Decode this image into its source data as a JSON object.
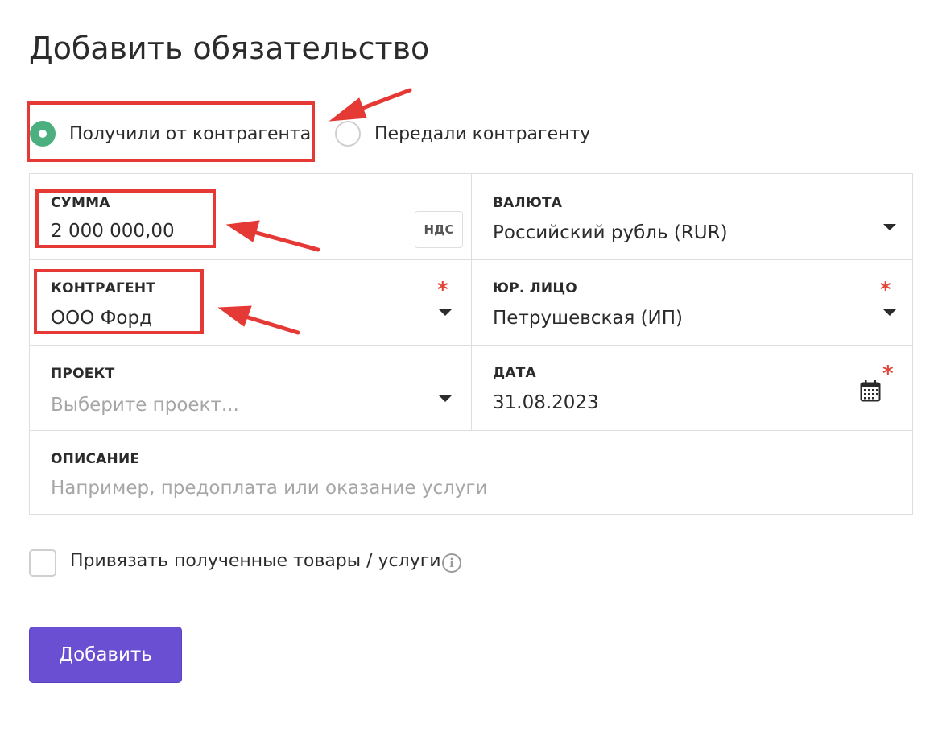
{
  "page": {
    "title": "Добавить обязательство"
  },
  "direction": {
    "options": [
      {
        "label": "Получили от контрагента",
        "selected": true
      },
      {
        "label": "Передали контрагенту",
        "selected": false
      }
    ]
  },
  "fields": {
    "amount": {
      "label": "СУММА",
      "value": "2 000 000,00",
      "vat_button": "НДС"
    },
    "currency": {
      "label": "ВАЛЮТА",
      "value": "Российский рубль (RUR)"
    },
    "counterparty": {
      "label": "КОНТРАГЕНТ",
      "value": "ООО Форд",
      "required_mark": "*"
    },
    "legal_entity": {
      "label": "ЮР. ЛИЦО",
      "value": "Петрушевская (ИП)",
      "required_mark": "*"
    },
    "project": {
      "label": "ПРОЕКТ",
      "placeholder": "Выберите проект..."
    },
    "date": {
      "label": "ДАТА",
      "value": "31.08.2023",
      "required_mark": "*"
    },
    "description": {
      "label": "ОПИСАНИЕ",
      "placeholder": "Например, предоплата или оказание услуги"
    }
  },
  "link_goods": {
    "label": "Привязать полученные товары / услуги",
    "info_symbol": "i",
    "checked": false
  },
  "submit": {
    "label": "Добавить"
  },
  "colors": {
    "accent": "#6a4fd3",
    "radio_selected": "#4caf7f",
    "required": "#e0463a",
    "annotation": "#e53935"
  },
  "icons": {
    "caret": "chevron-down-icon",
    "calendar": "calendar-icon",
    "info": "info-icon"
  }
}
